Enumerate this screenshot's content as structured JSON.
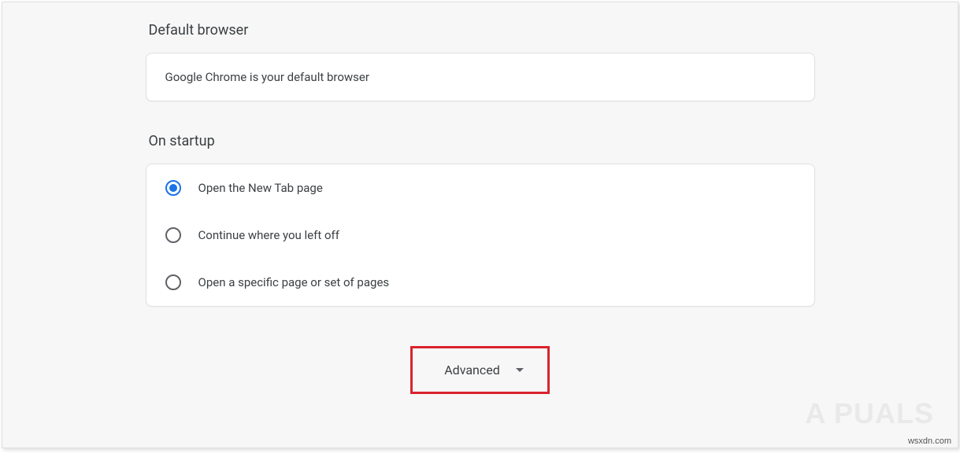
{
  "default_browser": {
    "title": "Default browser",
    "status": "Google Chrome is your default browser"
  },
  "on_startup": {
    "title": "On startup",
    "options": [
      {
        "label": "Open the New Tab page",
        "selected": true
      },
      {
        "label": "Continue where you left off",
        "selected": false
      },
      {
        "label": "Open a specific page or set of pages",
        "selected": false
      }
    ]
  },
  "advanced": {
    "label": "Advanced"
  },
  "watermark": "A PUALS",
  "source_url": "wsxdn.com"
}
